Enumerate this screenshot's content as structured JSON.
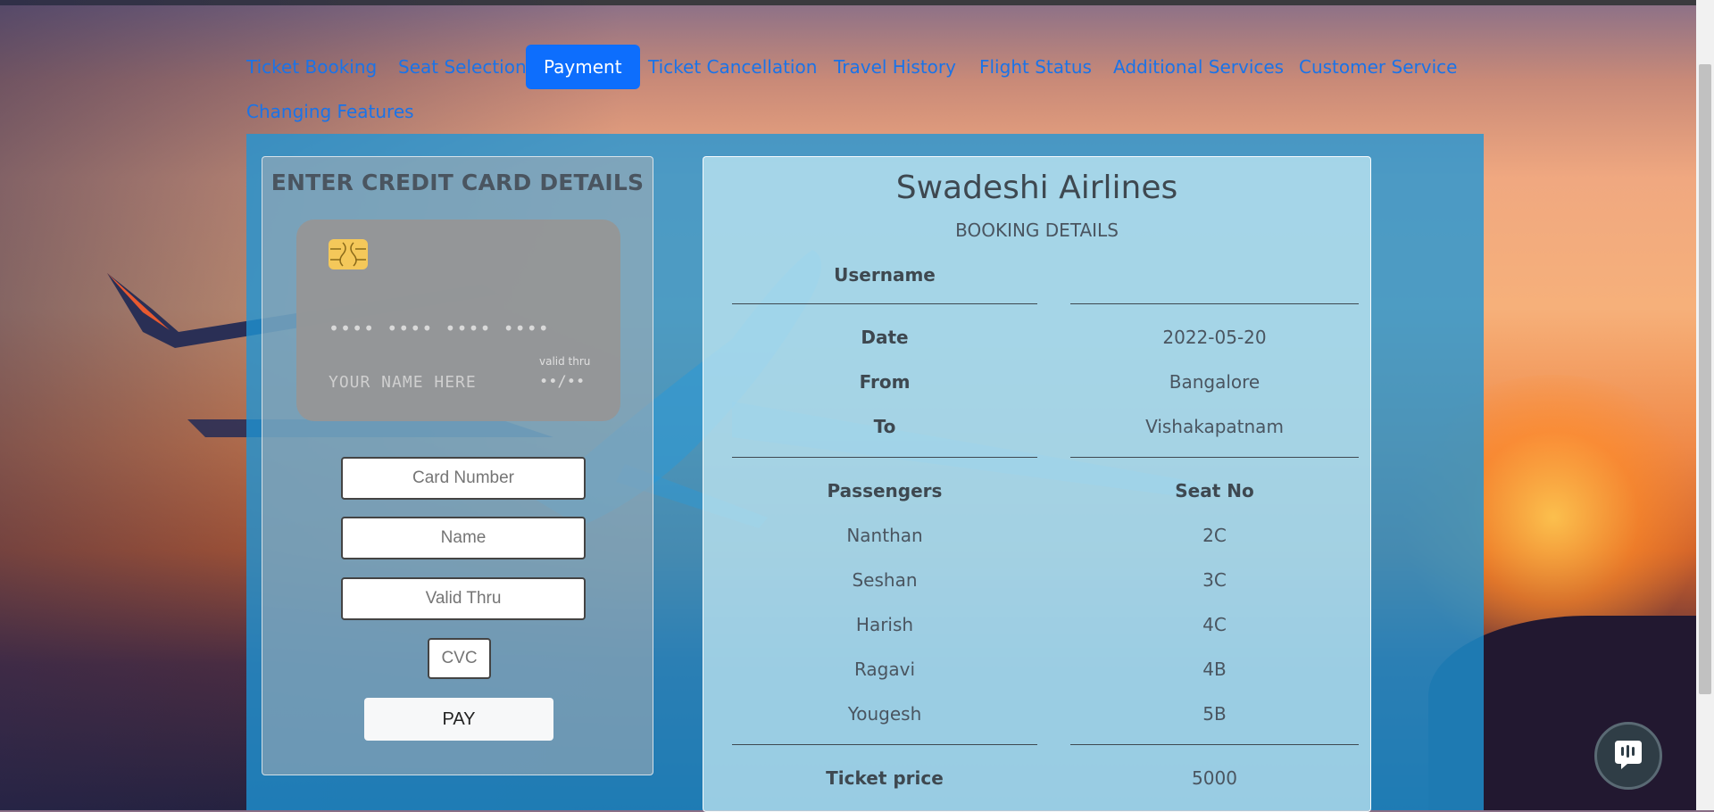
{
  "nav": {
    "tabs": [
      {
        "label": "Ticket Booking"
      },
      {
        "label": "Seat Selection"
      },
      {
        "label": "Payment"
      },
      {
        "label": "Ticket Cancellation"
      },
      {
        "label": "Travel History"
      },
      {
        "label": "Flight Status"
      },
      {
        "label": "Additional Services"
      },
      {
        "label": "Customer Service"
      },
      {
        "label": "Changing Features"
      }
    ],
    "active_tab": "Payment"
  },
  "payment": {
    "title": "ENTER CREDIT CARD DETAILS",
    "card_preview": {
      "number_mask": "•••• •••• •••• ••••",
      "name_placeholder": "YOUR NAME HERE",
      "valid_thru_label": "valid thru",
      "expiry_mask": "••/••"
    },
    "fields": {
      "card_number": {
        "placeholder": "Card Number",
        "value": ""
      },
      "name": {
        "placeholder": "Name",
        "value": ""
      },
      "valid_thru": {
        "placeholder": "Valid Thru",
        "value": ""
      },
      "cvc": {
        "placeholder": "CVC",
        "value": ""
      }
    },
    "pay_label": "PAY"
  },
  "booking": {
    "airline": "Swadeshi Airlines",
    "subtitle": "BOOKING DETAILS",
    "username_label": "Username",
    "username_value": "",
    "date_label": "Date",
    "date_value": "2022-05-20",
    "from_label": "From",
    "from_value": "Bangalore",
    "to_label": "To",
    "to_value": "Vishakapatnam",
    "passengers_header": "Passengers",
    "seat_header": "Seat No",
    "passengers": [
      {
        "name": "Nanthan",
        "seat": "2C"
      },
      {
        "name": "Seshan",
        "seat": "3C"
      },
      {
        "name": "Harish",
        "seat": "4C"
      },
      {
        "name": "Ragavi",
        "seat": "4B"
      },
      {
        "name": "Yougesh",
        "seat": "5B"
      }
    ],
    "price_label": "Ticket price",
    "price_value": "5000"
  },
  "colors": {
    "accent": "#0d6efd",
    "link": "#1a73e8",
    "panel": "#1e96d7"
  },
  "icons": {
    "chat": "chat-icon",
    "chip": "card-chip-icon"
  }
}
